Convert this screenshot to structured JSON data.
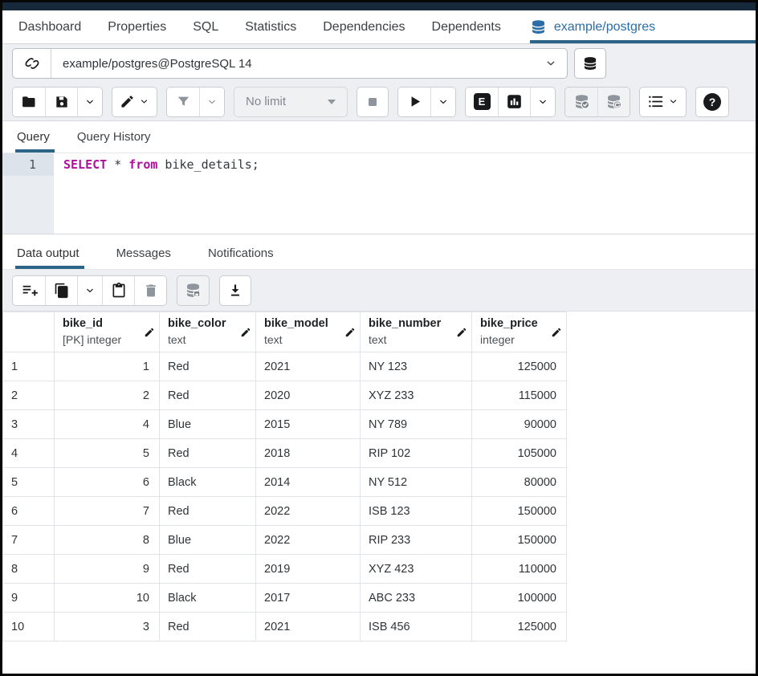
{
  "nav": {
    "tabs": [
      "Dashboard",
      "Properties",
      "SQL",
      "Statistics",
      "Dependencies",
      "Dependents"
    ],
    "active_tab": "example/postgres"
  },
  "connection": {
    "value": "example/postgres@PostgreSQL 14"
  },
  "toolbar": {
    "limit_label": "No limit",
    "explain_glyph": "E",
    "help_glyph": "?"
  },
  "editor": {
    "tabs": [
      "Query",
      "Query History"
    ],
    "active_tab": "Query",
    "line_number": "1",
    "sql": {
      "kw1": "SELECT",
      "star": " * ",
      "kw2": "from",
      "rest": " bike_details;"
    }
  },
  "results": {
    "tabs": [
      "Data output",
      "Messages",
      "Notifications"
    ],
    "active_tab": "Data output"
  },
  "grid": {
    "columns": [
      {
        "name": "bike_id",
        "type": "[PK] integer",
        "align": "right"
      },
      {
        "name": "bike_color",
        "type": "text",
        "align": "left"
      },
      {
        "name": "bike_model",
        "type": "text",
        "align": "left"
      },
      {
        "name": "bike_number",
        "type": "text",
        "align": "left"
      },
      {
        "name": "bike_price",
        "type": "integer",
        "align": "right"
      }
    ],
    "rows": [
      {
        "num": "1",
        "cells": [
          "1",
          "Red",
          "2021",
          "NY 123",
          "125000"
        ]
      },
      {
        "num": "2",
        "cells": [
          "2",
          "Red",
          "2020",
          "XYZ 233",
          "115000"
        ]
      },
      {
        "num": "3",
        "cells": [
          "4",
          "Blue",
          "2015",
          "NY 789",
          "90000"
        ]
      },
      {
        "num": "4",
        "cells": [
          "5",
          "Red",
          "2018",
          "RIP 102",
          "105000"
        ]
      },
      {
        "num": "5",
        "cells": [
          "6",
          "Black",
          "2014",
          "NY 512",
          "80000"
        ]
      },
      {
        "num": "6",
        "cells": [
          "7",
          "Red",
          "2022",
          "ISB 123",
          "150000"
        ]
      },
      {
        "num": "7",
        "cells": [
          "8",
          "Blue",
          "2022",
          "RIP 233",
          "150000"
        ]
      },
      {
        "num": "8",
        "cells": [
          "9",
          "Red",
          "2019",
          "XYZ 423",
          "110000"
        ]
      },
      {
        "num": "9",
        "cells": [
          "10",
          "Black",
          "2017",
          "ABC 233",
          "100000"
        ]
      },
      {
        "num": "10",
        "cells": [
          "3",
          "Red",
          "2021",
          "ISB 456",
          "125000"
        ]
      }
    ]
  },
  "colors": {
    "accent_underline": "#2c6487",
    "active_tab_text": "#2a6da9",
    "sql_keyword": "#b10f9f",
    "toolbar_bg": "#edeff2",
    "disabled_icon": "#8f959c",
    "top_strip": "#16293a"
  },
  "icons": {
    "database-icon": "db cylinder",
    "connection-icon": "plug knot",
    "open-file-icon": "folder",
    "save-icon": "floppy disk",
    "edit-icon": "pencil",
    "filter-icon": "funnel",
    "stop-icon": "square",
    "execute-icon": "play triangle",
    "explain-icon": "E badge",
    "explain-analyze-icon": "bar chart badge",
    "commit-icon": "db + check",
    "rollback-icon": "db + undo arrow",
    "macro-icon": "numbered list",
    "help-icon": "question mark",
    "add-row-icon": "lines + plus",
    "copy-icon": "two pages",
    "paste-icon": "clipboard",
    "delete-row-icon": "trash can",
    "save-data-icon": "db + save",
    "download-icon": "arrow down to line",
    "chevron-down-icon": "chevron"
  }
}
